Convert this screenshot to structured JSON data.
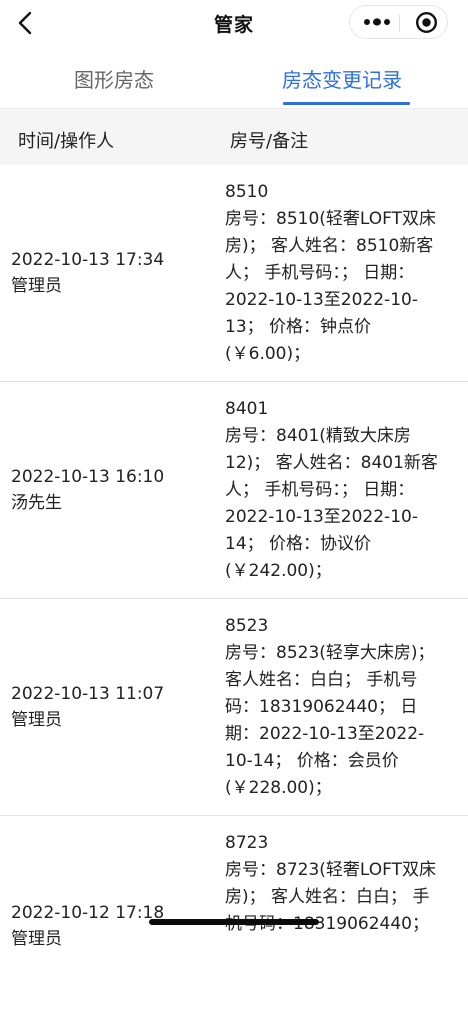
{
  "nav": {
    "title": "管家",
    "back_icon": "chevron-left-icon",
    "more_icon": "more-dots-icon",
    "close_icon": "target-icon"
  },
  "tabs": [
    {
      "label": "图形房态",
      "active": false
    },
    {
      "label": "房态变更记录",
      "active": true
    }
  ],
  "accent_color": "#2f6fe0",
  "table": {
    "headers": [
      "时间/操作人",
      "房号/备注"
    ],
    "rows": [
      {
        "time": "2022-10-13 17:34",
        "operator": "管理员",
        "note_lines": [
          "8510",
          "房号：8510(轻奢LOFT双床",
          "房)； 客人姓名：8510新客",
          "人； 手机号码：； 日期：",
          "2022-10-13至2022-10-",
          "13； 价格：钟点价",
          "(￥6.00)；"
        ]
      },
      {
        "time": "2022-10-13 16:10",
        "operator": "汤先生",
        "note_lines": [
          "8401",
          "房号：8401(精致大床房",
          "12)； 客人姓名：8401新客",
          "人； 手机号码：； 日期：",
          "2022-10-13至2022-10-",
          "14； 价格：协议价",
          "(￥242.00)；"
        ]
      },
      {
        "time": "2022-10-13 11:07",
        "operator": "管理员",
        "note_lines": [
          "8523",
          "房号：8523(轻享大床房)；",
          "客人姓名：白白； 手机号",
          "码：18319062440； 日",
          "期：2022-10-13至2022-",
          "10-14； 价格：会员价",
          "(￥228.00)；"
        ]
      },
      {
        "time": "2022-10-12 17:18",
        "operator": "管理员",
        "note_lines": [
          "8723",
          "房号：8723(轻奢LOFT双床",
          "房)； 客人姓名：白白； 手",
          "机号码：18319062440；"
        ]
      }
    ]
  }
}
